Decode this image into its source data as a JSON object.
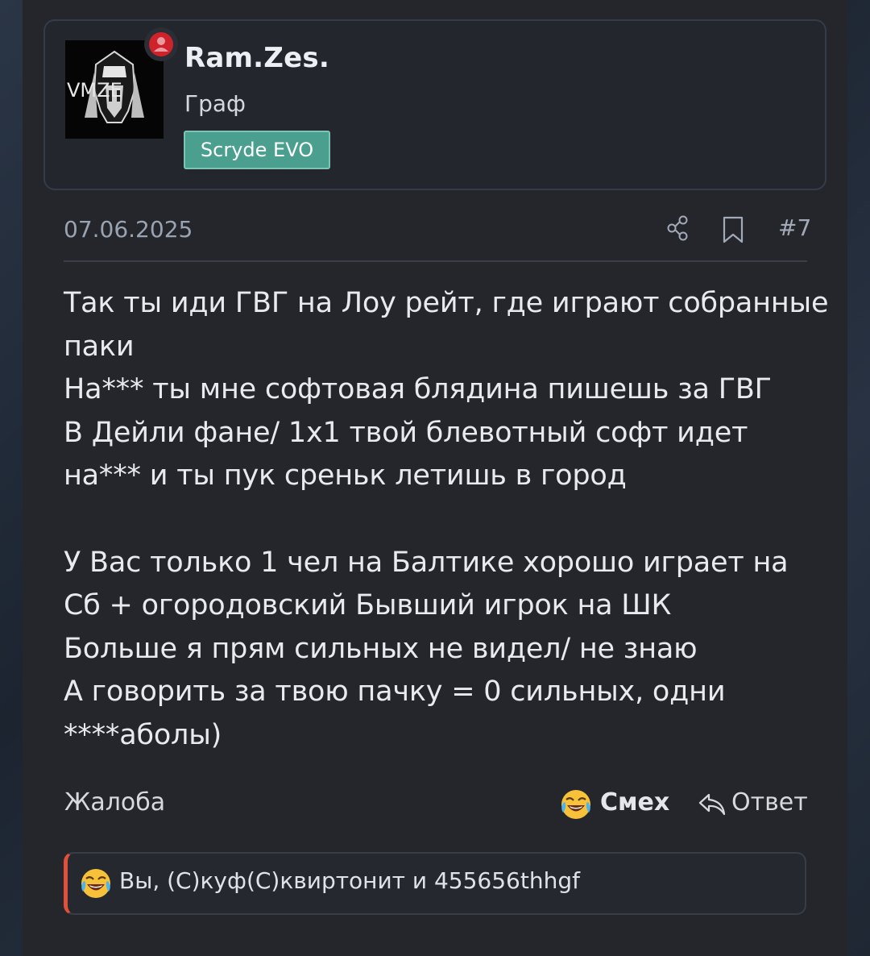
{
  "user": {
    "name": "Ram.Zes.",
    "title": "Граф",
    "badge": "Scryde EVO",
    "avatar_text": "VMZE",
    "status_color": "#d0222b",
    "badge_color": "#4a9f8f"
  },
  "post": {
    "date": "07.06.2025",
    "number": "#7",
    "lines": [
      "Так ты иди ГВГ на Лоу рейт, где играют собранные",
      "паки",
      "На*** ты мне софтовая блядина пишешь за ГВГ",
      "В Дейли фане/ 1х1 твой блевотный софт идет",
      "на*** и ты пук среньк летишь в город",
      "",
      "У Вас только 1 чел на Балтике хорошо играет на",
      "Сб + огородовский Бывший игрок на ШК",
      "Больше я прям сильных не видел/ не знаю",
      "А говорить за твою пачку = 0 сильных, одни",
      "****аболы)"
    ]
  },
  "actions": {
    "report": "Жалоба",
    "laugh": "Смех",
    "reply": "Ответ"
  },
  "reactions": {
    "text": "Вы, (С)куф(С)квиртонит и 455656thhgf",
    "accent_color": "#e0503a"
  }
}
